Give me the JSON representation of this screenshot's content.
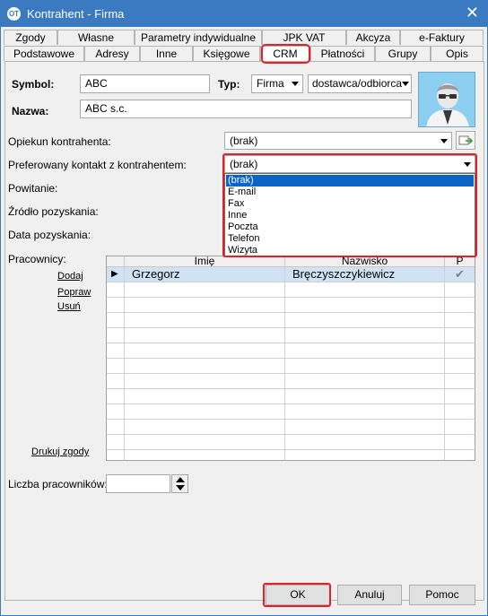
{
  "window": {
    "title": "Kontrahent - Firma",
    "app_badge": "OT"
  },
  "tabs_top": [
    "Zgody",
    "Własne",
    "Parametry indywidualne",
    "JPK VAT",
    "Akcyza",
    "e-Faktury"
  ],
  "tabs_bottom": [
    "Podstawowe",
    "Adresy",
    "Inne",
    "Księgowe",
    "CRM",
    "Płatności",
    "Grupy",
    "Opis"
  ],
  "active_tab": "CRM",
  "form": {
    "symbol_label": "Symbol:",
    "symbol_value": "ABC",
    "typ_label": "Typ:",
    "typ_value": "Firma",
    "typ2_value": "dostawca/odbiorca",
    "nazwa_label": "Nazwa:",
    "nazwa_value": "ABC s.c.",
    "opiekun_label": "Opiekun kontrahenta:",
    "opiekun_value": "(brak)",
    "preferowany_label": "Preferowany kontakt z kontrahentem:",
    "preferowany_value": "(brak)",
    "powitanie_label": "Powitanie:",
    "zrodlo_label": "Źródło pozyskania:",
    "data_label": "Data pozyskania:",
    "pracownicy_label": "Pracownicy:",
    "liczba_label": "Liczba pracowników:",
    "liczba_value": ""
  },
  "dropdown_options": [
    "(brak)",
    "E-mail",
    "Fax",
    "Inne",
    "Poczta",
    "Telefon",
    "Wizyta"
  ],
  "dropdown_selected": "(brak)",
  "grid": {
    "columns": [
      "Imię",
      "Nazwisko",
      "P"
    ],
    "rows": [
      {
        "imie": "Grzegorz",
        "nazwisko": "Bręczyszczykiewicz",
        "p": "✔"
      }
    ]
  },
  "links": {
    "dodaj": "Dodaj",
    "popraw": "Popraw",
    "usun": "Usuń",
    "drukuj": "Drukuj zgody"
  },
  "buttons": {
    "ok": "OK",
    "anuluj": "Anuluj",
    "pomoc": "Pomoc"
  },
  "colors": {
    "titlebar": "#3b79c1",
    "highlight": "#e0202a",
    "selection": "#0a64c8",
    "avatar_bg": "#8ccff0"
  }
}
